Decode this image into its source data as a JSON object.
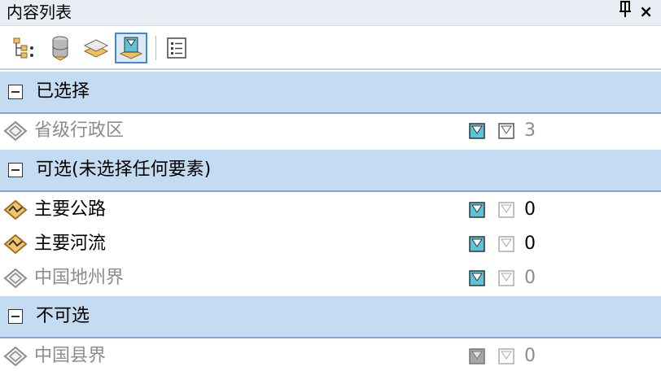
{
  "panel": {
    "title": "内容列表",
    "pin_glyph": "ꟼ",
    "close_glyph": "×"
  },
  "toolbar": {
    "buttons": [
      {
        "icon": "list-by-drawing-order-icon"
      },
      {
        "icon": "list-by-source-icon"
      },
      {
        "icon": "list-by-visibility-icon"
      },
      {
        "icon": "list-by-selection-icon",
        "active": true
      },
      {
        "icon": "options-icon"
      }
    ]
  },
  "groups": [
    {
      "label": "已选择",
      "layers": [
        {
          "name": "省级行政区",
          "count": "3",
          "dim": true,
          "icon": "polygon-layer-icon"
        }
      ]
    },
    {
      "label": "可选(未选择任何要素)",
      "layers": [
        {
          "name": "主要公路",
          "count": "0",
          "dim": false,
          "icon": "line-layer-icon"
        },
        {
          "name": "主要河流",
          "count": "0",
          "dim": false,
          "icon": "line-layer-icon"
        },
        {
          "name": "中国地州界",
          "count": "0",
          "dim": true,
          "icon": "polygon-layer-icon"
        }
      ]
    },
    {
      "label": "不可选",
      "layers": [
        {
          "name": "中国县界",
          "count": "0",
          "dim": true,
          "icon": "polygon-layer-icon"
        }
      ]
    }
  ],
  "colors": {
    "group_bg": "#c4dcf2",
    "group_border": "#7fa8d6",
    "line_icon": "#f4c56b",
    "dim_text": "#8c8c8c"
  }
}
